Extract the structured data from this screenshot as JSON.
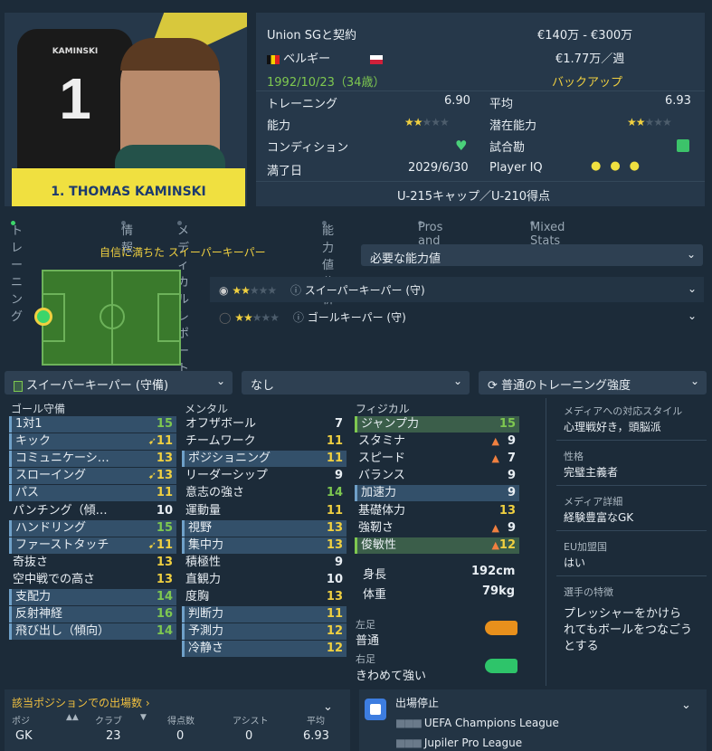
{
  "player": {
    "jersey_name": "KAMINSKI",
    "number": "1",
    "title": "1. THOMAS KAMINSKI"
  },
  "info": {
    "contract": "Union SGと契約",
    "value": "€140万 - €300万",
    "nationality": "ベルギー",
    "wage": "€1.77万／週",
    "dob": "1992/10/23（34歳）",
    "squad_status": "バックアップ",
    "training_label": "トレーニング",
    "training_value": "6.90",
    "avg_label": "平均",
    "avg_value": "6.93",
    "ability_label": "能力",
    "potential_label": "潜在能力",
    "condition_label": "コンディション",
    "match_label": "試合勘",
    "expiry_label": "満了日",
    "expiry_value": "2029/6/30",
    "iq_label": "Player IQ",
    "caps": "U-215キャップ／U-210得点"
  },
  "tabs": [
    "トレーニング",
    "情報",
    "メディカルレポート",
    "能力値分析",
    "Pros and Cons",
    "Mixed Stats"
  ],
  "role_title": "自信に満ちた スイーパーキーパー",
  "required_attr": "必要な能力値",
  "roles": [
    {
      "label": "スイーパーキーパー (守)"
    },
    {
      "label": "ゴールキーパー (守)"
    }
  ],
  "controls": {
    "position": "スイーパーキーパー (守備)",
    "focus": "なし",
    "intensity": "普通のトレーニング強度"
  },
  "headers": {
    "gk": "ゴール守備",
    "mental": "メンタル",
    "physical": "フィジカル"
  },
  "gk_attrs": [
    {
      "l": "1対1",
      "v": "15"
    },
    {
      "l": "キック",
      "v": "11"
    },
    {
      "l": "コミュニケーシ…",
      "v": "13"
    },
    {
      "l": "スローイング",
      "v": "13"
    },
    {
      "l": "パス",
      "v": "11"
    },
    {
      "l": "パンチング（傾…",
      "v": "10"
    },
    {
      "l": "ハンドリング",
      "v": "15"
    },
    {
      "l": "ファーストタッチ",
      "v": "11"
    },
    {
      "l": "奇抜さ",
      "v": "13"
    },
    {
      "l": "空中戦での高さ",
      "v": "13"
    },
    {
      "l": "支配力",
      "v": "14"
    },
    {
      "l": "反射神経",
      "v": "16"
    },
    {
      "l": "飛び出し（傾向）",
      "v": "14"
    }
  ],
  "mental_attrs": [
    {
      "l": "オフザボール",
      "v": "7"
    },
    {
      "l": "チームワーク",
      "v": "11"
    },
    {
      "l": "ポジショニング",
      "v": "11"
    },
    {
      "l": "リーダーシップ",
      "v": "9"
    },
    {
      "l": "意志の強さ",
      "v": "14"
    },
    {
      "l": "運動量",
      "v": "11"
    },
    {
      "l": "視野",
      "v": "13"
    },
    {
      "l": "集中力",
      "v": "13"
    },
    {
      "l": "積極性",
      "v": "9"
    },
    {
      "l": "直観力",
      "v": "10"
    },
    {
      "l": "度胸",
      "v": "13"
    },
    {
      "l": "判断力",
      "v": "11"
    },
    {
      "l": "予測力",
      "v": "12"
    },
    {
      "l": "冷静さ",
      "v": "12"
    }
  ],
  "physical_attrs": [
    {
      "l": "ジャンプ力",
      "v": "15"
    },
    {
      "l": "スタミナ",
      "v": "9"
    },
    {
      "l": "スピード",
      "v": "7"
    },
    {
      "l": "バランス",
      "v": "9"
    },
    {
      "l": "加速力",
      "v": "9"
    },
    {
      "l": "基礎体力",
      "v": "13"
    },
    {
      "l": "強靭さ",
      "v": "9"
    },
    {
      "l": "俊敏性",
      "v": "12"
    }
  ],
  "body": {
    "height_l": "身長",
    "height_v": "192cm",
    "weight_l": "体重",
    "weight_v": "79kg",
    "left_l": "左足",
    "left_v": "普通",
    "right_l": "右足",
    "right_v": "きわめて強い"
  },
  "side": {
    "media_style_l": "メディアへの対応スタイル",
    "media_style_v": "心理戦好き，頭脳派",
    "personality_l": "性格",
    "personality_v": "完璧主義者",
    "media_desc_l": "メディア詳細",
    "media_desc_v": "経験豊富なGK",
    "eu_l": "EU加盟国",
    "eu_v": "はい",
    "traits_l": "選手の特徴",
    "traits_v1": "プレッシャーをかけら",
    "traits_v2": "れてもボールをつなごう",
    "traits_v3": "とする"
  },
  "apps": {
    "title": "該当ポジションでの出場数 ›",
    "cols": [
      "ポジ",
      "クラブ",
      "得点数",
      "アシスト",
      "平均"
    ],
    "row": [
      "GK",
      "23",
      "0",
      "0",
      "6.93"
    ]
  },
  "suspension": {
    "title": "出場停止",
    "c1": "UEFA Champions League",
    "c2": "Jupiler Pro League"
  },
  "colors": {
    "accent_yellow": "#f0e040",
    "green": "#7ec850",
    "bg": "#1c2b39"
  }
}
